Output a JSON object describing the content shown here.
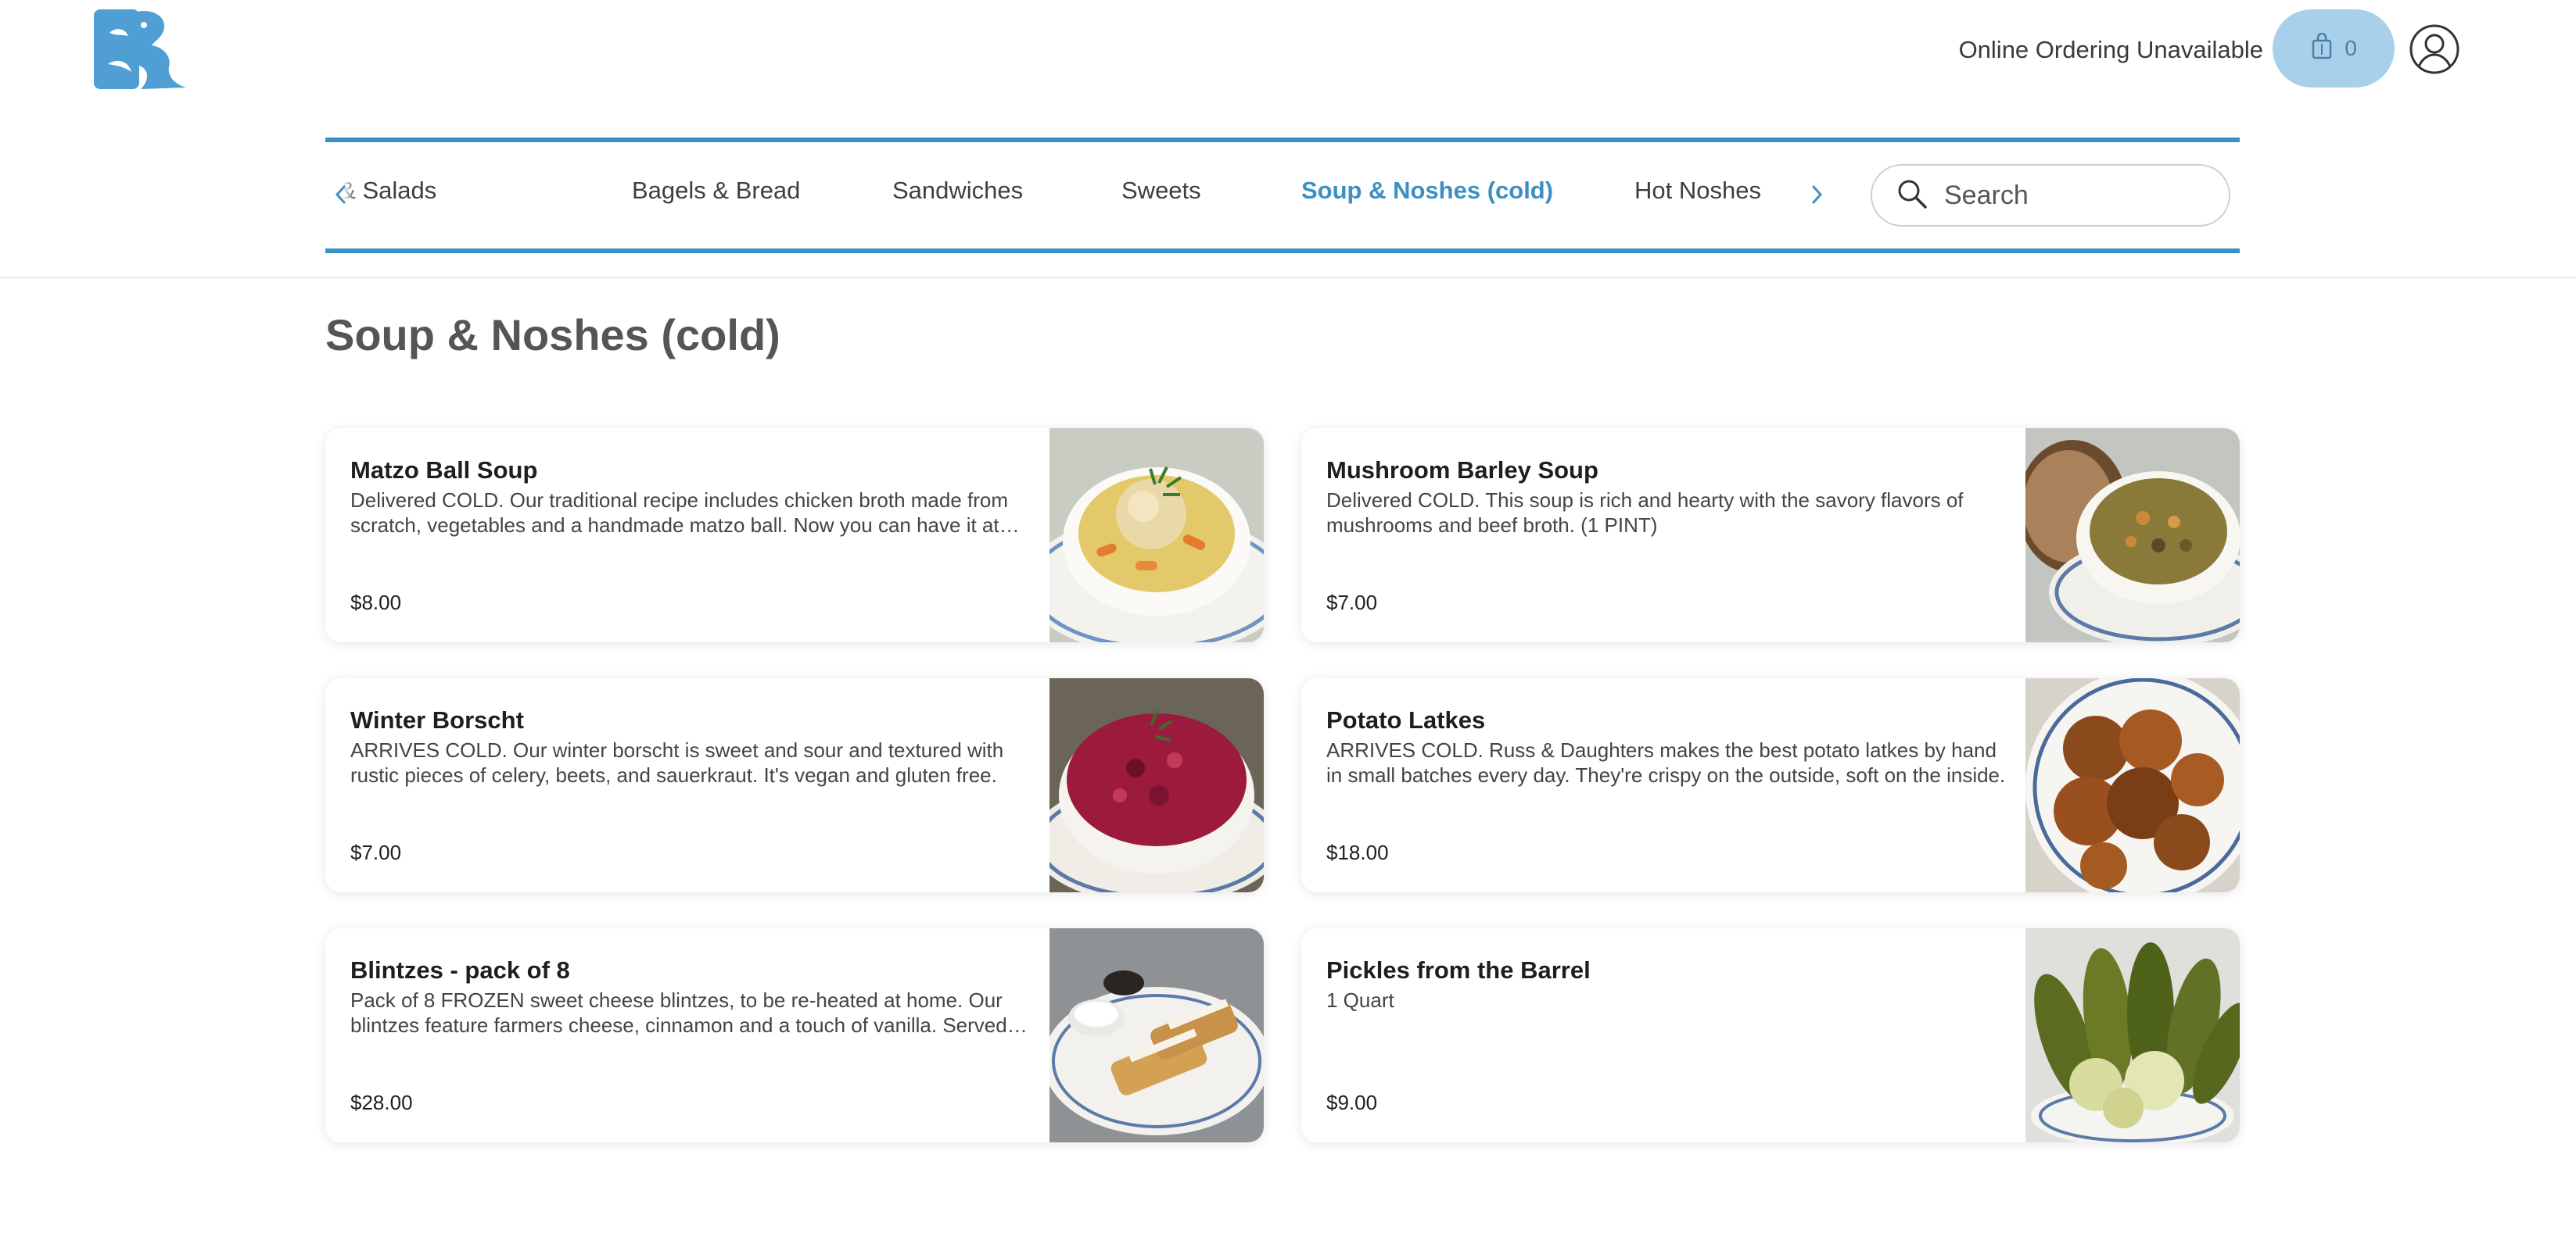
{
  "header": {
    "logo_name": "fish-logo",
    "ordering_status": "Online Ordering Unavailable",
    "cart_count": "0",
    "brand_color": "#3d91c7"
  },
  "nav": {
    "categories": [
      {
        "label": "Schmears & Salads",
        "active": false
      },
      {
        "label": "Bagels & Bread",
        "active": false
      },
      {
        "label": "Sandwiches",
        "active": false
      },
      {
        "label": "Sweets",
        "active": false
      },
      {
        "label": "Soup & Noshes (cold)",
        "active": true
      },
      {
        "label": "Hot Noshes",
        "active": false
      }
    ],
    "search_placeholder": "Search"
  },
  "section": {
    "title": "Soup & Noshes (cold)",
    "items": [
      {
        "name": "Matzo Ball Soup",
        "description": "Delivered COLD. Our traditional recipe includes chicken broth made from scratch, vegetables and a handmade matzo ball. Now you can have it at home.",
        "price": "$8.00",
        "image": "matzo-ball-soup-photo"
      },
      {
        "name": "Mushroom Barley Soup",
        "description": "Delivered COLD. This soup is rich and hearty with the savory flavors of mushrooms and beef broth. (1 PINT)",
        "price": "$7.00",
        "image": "mushroom-barley-soup-photo"
      },
      {
        "name": "Winter Borscht",
        "description": "ARRIVES COLD. Our winter borscht is sweet and sour and textured with rustic pieces of celery, beets, and sauerkraut. It's vegan and gluten free.",
        "price": "$7.00",
        "image": "winter-borscht-photo"
      },
      {
        "name": "Potato Latkes",
        "description": "ARRIVES COLD. Russ & Daughters makes the best potato latkes by hand in small batches every day. They're crispy on the outside, soft on the inside.",
        "price": "$18.00",
        "image": "potato-latkes-photo"
      },
      {
        "name": "Blintzes - pack of 8",
        "description": "Pack of 8 FROZEN sweet cheese blintzes, to be re-heated at home. Our blintzes feature farmers cheese, cinnamon and a touch of vanilla. Served with sour cream.",
        "price": "$28.00",
        "image": "blintzes-photo"
      },
      {
        "name": "Pickles from the Barrel",
        "description": "1 Quart",
        "price": "$9.00",
        "image": "pickles-photo"
      }
    ]
  }
}
